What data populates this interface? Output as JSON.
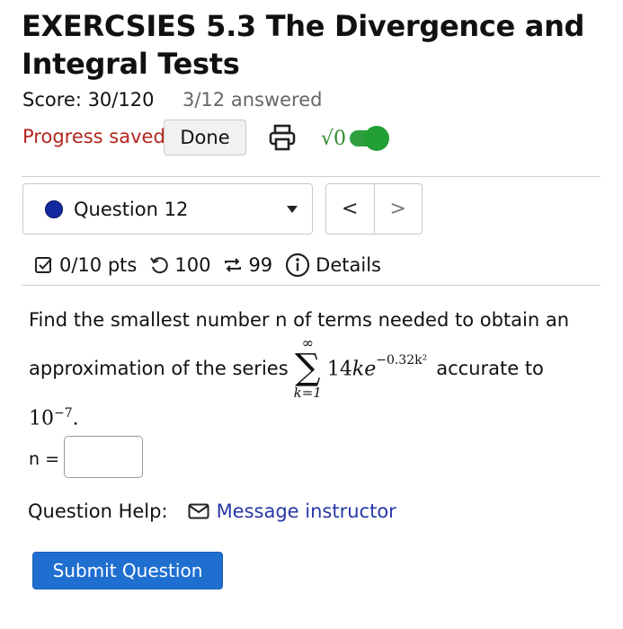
{
  "header": {
    "title": "EXERCSIES 5.3 The Divergence and Integral Tests",
    "score": "Score: 30/120",
    "answered": "3/12 answered",
    "progress_status": "Progress saved",
    "done_label": "Done",
    "math_toggle_label": "√0",
    "math_toggle_on": true
  },
  "question_nav": {
    "selected_question": "Question 12",
    "prev_label": "<",
    "next_label": ">"
  },
  "question_meta": {
    "points": "0/10 pts",
    "attempts": "100",
    "versions": "99",
    "details_label": "Details"
  },
  "question": {
    "text_line1": "Find the smallest number n of terms needed to obtain an",
    "text_prefix": "approximation of the series",
    "sum_upper": "∞",
    "sum_symbol": "∑",
    "sum_lower": "k=1",
    "term_coeff": "14",
    "term_k": "k",
    "term_e": "e",
    "term_exponent": "−0.32k²",
    "text_suffix": "accurate to",
    "tolerance_base": "10",
    "tolerance_exponent": "−7",
    "tolerance_end": ".",
    "answer_label": "n =",
    "answer_value": ""
  },
  "help": {
    "label": "Question Help:",
    "message_link": "Message instructor"
  },
  "submit_label": "Submit Question",
  "colors": {
    "progress_saved": "#b3261e",
    "toggle_green": "#22a033",
    "question_dot": "#1428a0",
    "link": "#2838a8",
    "submit_bg": "#1f6fd0"
  }
}
